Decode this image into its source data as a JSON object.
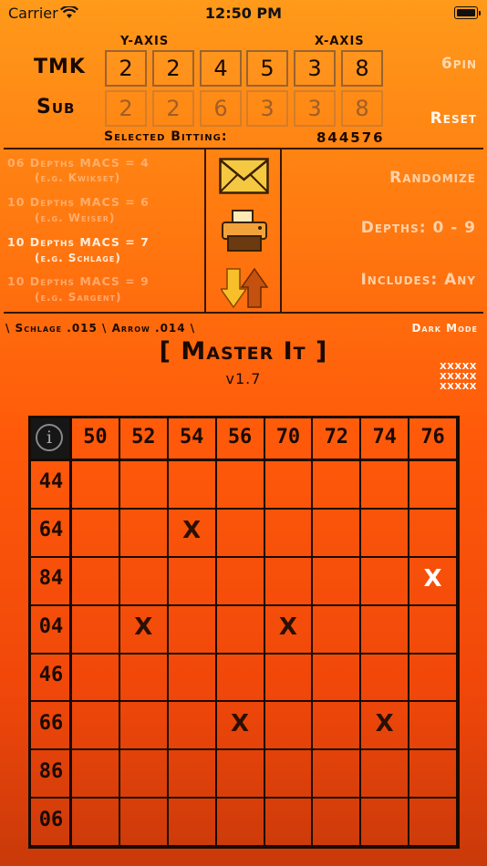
{
  "status_bar": {
    "carrier": "Carrier",
    "time": "12:50 PM"
  },
  "bitting": {
    "y_axis_label": "Y-AXIS",
    "x_axis_label": "X-AXIS",
    "tmk_label": "TMK",
    "sub_label": "Sub",
    "tmk_values": [
      "2",
      "2",
      "4",
      "5",
      "3",
      "8"
    ],
    "sub_values": [
      "2",
      "2",
      "6",
      "3",
      "3",
      "8"
    ],
    "selected_label": "Selected Bitting:",
    "selected_value": "844576"
  },
  "controls": {
    "pin_label": "6pin",
    "reset_label": "Reset"
  },
  "macs_options": [
    {
      "title": "06 Depths MACS = 4",
      "example": "(e.g. Kwikset)"
    },
    {
      "title": "10 Depths MACS = 6",
      "example": "(e.g. Weiser)"
    },
    {
      "title": "10 Depths MACS = 7",
      "example": "(e.g. Schlage)"
    },
    {
      "title": "10 Depths MACS = 9",
      "example": "(e.g. Sargent)"
    }
  ],
  "options": {
    "randomize": "Randomize",
    "depths": "Depths: 0 - 9",
    "includes": "Includes: Any"
  },
  "icons": [
    "envelope-icon",
    "printer-icon",
    "swap-arrows-icon",
    "info-icon"
  ],
  "footer": {
    "key_spec": "\\ Schlage .015 \\ Arrow .014 \\",
    "dark_mode": "Dark Mode",
    "title": "[ Master It ]",
    "version": "v1.7",
    "x_rows": [
      "XXXXX",
      "XXXXX",
      "XXXXX"
    ]
  },
  "grid": {
    "columns": [
      "50",
      "52",
      "54",
      "56",
      "70",
      "72",
      "74",
      "76"
    ],
    "rows": [
      "44",
      "64",
      "84",
      "04",
      "46",
      "66",
      "86",
      "06"
    ],
    "marks": [
      {
        "row": 1,
        "col": 2,
        "text": "X",
        "light": false
      },
      {
        "row": 2,
        "col": 7,
        "text": "X",
        "light": true
      },
      {
        "row": 3,
        "col": 1,
        "text": "X",
        "light": false
      },
      {
        "row": 3,
        "col": 4,
        "text": "X",
        "light": false
      },
      {
        "row": 5,
        "col": 3,
        "text": "X",
        "light": false
      },
      {
        "row": 5,
        "col": 6,
        "text": "X",
        "light": false
      }
    ]
  },
  "colors": {
    "gradient_top": "#ff9a1a",
    "gradient_bottom": "#c9390a",
    "ink": "#1a0a00"
  }
}
